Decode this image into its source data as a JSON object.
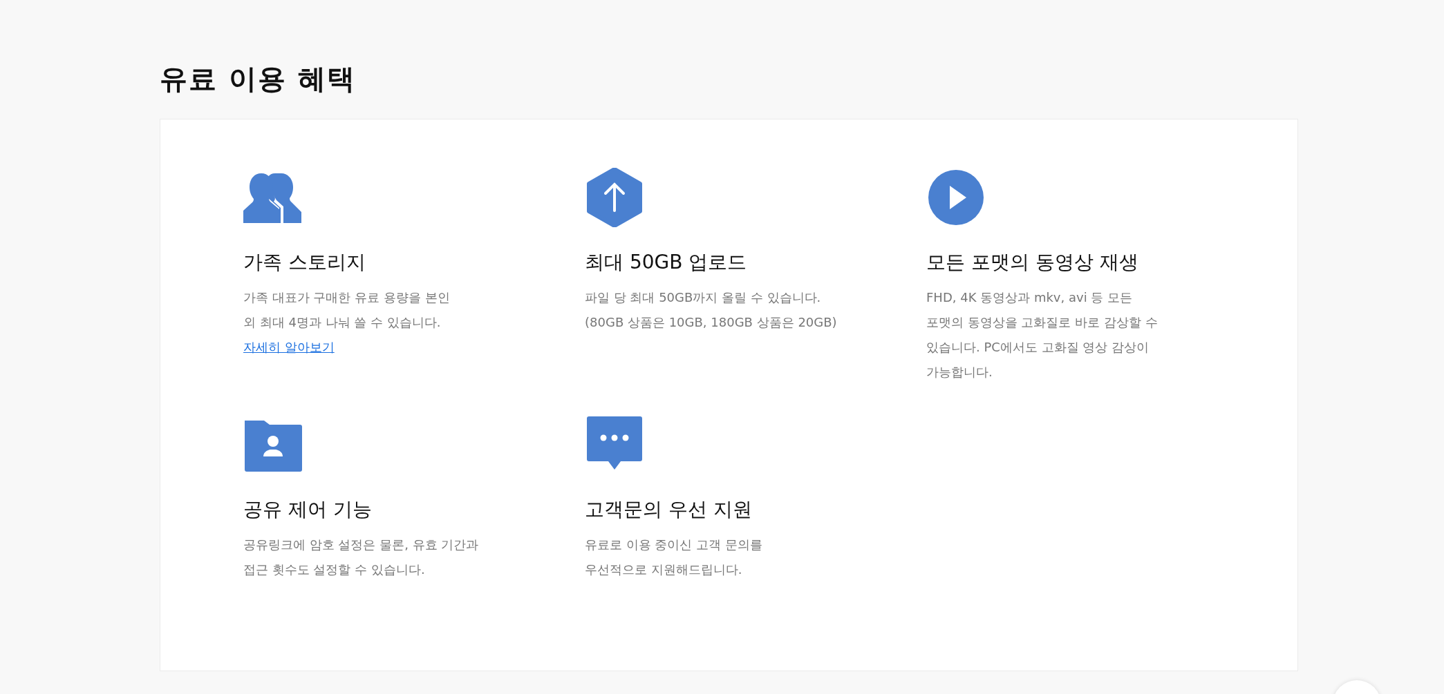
{
  "heading": "유료 이용 혜택",
  "benefits": [
    {
      "kind": "family",
      "title": "가족 스토리지",
      "description": "가족 대표가 구매한 유료 용량을 본인\n외 최대 4명과 나눠 쓸 수 있습니다.",
      "link": "자세히 알아보기"
    },
    {
      "kind": "upload",
      "title": "최대 50GB 업로드",
      "description": "파일 당 최대 50GB까지 올릴 수 있습니다.\n(80GB 상품은 10GB, 180GB 상품은 20GB)"
    },
    {
      "kind": "play",
      "title": "모든 포맷의 동영상 재생",
      "description": "FHD, 4K 동영상과 mkv, avi 등 모든\n포맷의 동영상을 고화질로 바로 감상할 수\n있습니다. PC에서도 고화질 영상 감상이\n가능합니다."
    },
    {
      "kind": "share",
      "title": "공유 제어 기능",
      "description": "공유링크에 암호 설정은 물론, 유효 기간과\n접근 횟수도 설정할 수 있습니다."
    },
    {
      "kind": "support",
      "title": "고객문의 우선 지원",
      "description": "유료로 이용 중이신 고객 문의를\n우선적으로 지원해드립니다."
    }
  ]
}
